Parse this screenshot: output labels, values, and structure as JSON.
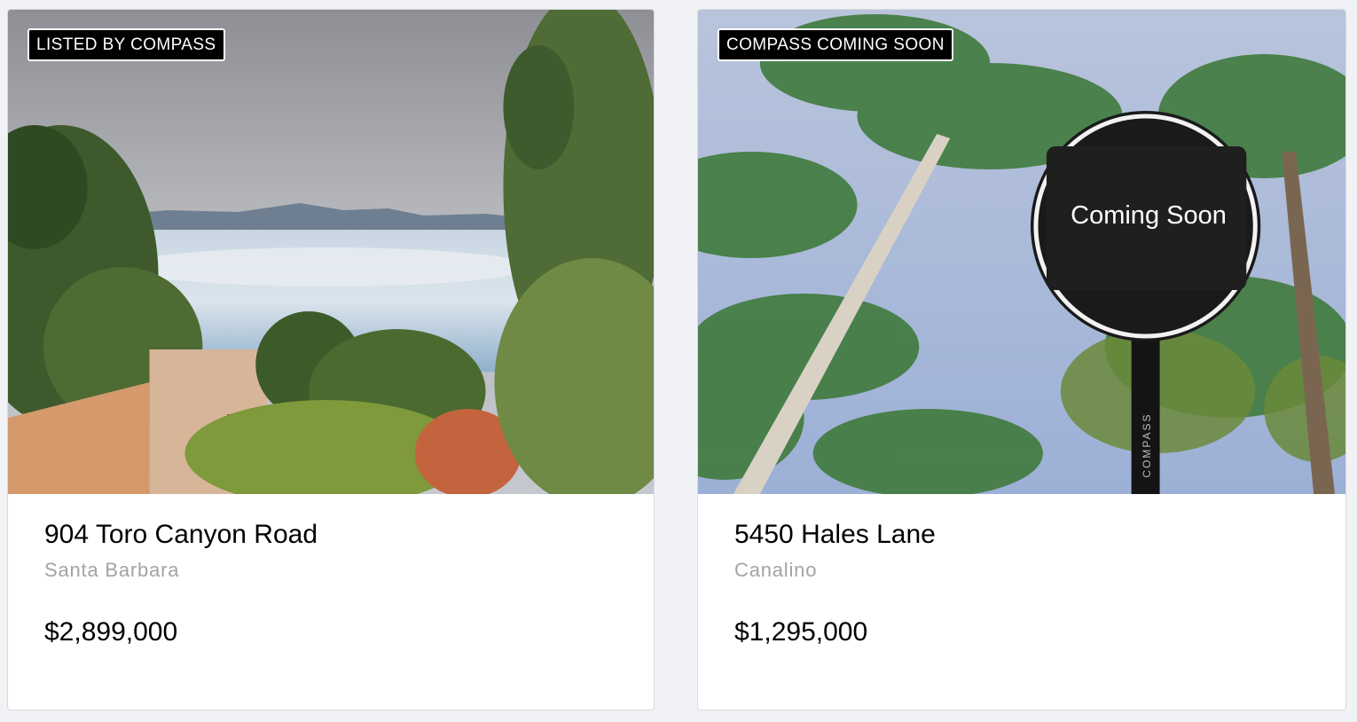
{
  "listings": [
    {
      "badge": "LISTED BY COMPASS",
      "address": "904 Toro Canyon Road",
      "city": "Santa Barbara",
      "price": "$2,899,000",
      "photo_icon": "ocean-view-photo"
    },
    {
      "badge": "COMPASS COMING SOON",
      "address": "5450 Hales Lane",
      "city": "Canalino",
      "price": "$1,295,000",
      "photo_icon": "palm-trees-photo",
      "sign_text": "Coming Soon",
      "sign_brand": "COMPASS"
    }
  ],
  "colors": {
    "page_background": "#f1f2f6",
    "badge_background": "#000000",
    "city_text": "#a3a3a3"
  }
}
